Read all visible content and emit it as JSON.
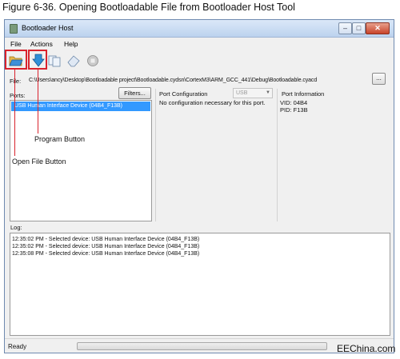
{
  "caption": "Figure 6-36.  Opening Bootloadable File from Bootloader Host Tool",
  "window": {
    "title": "Bootloader Host",
    "controls": {
      "minimize": "–",
      "maximize": "□",
      "close": "✕"
    }
  },
  "menu": {
    "file": "File",
    "actions": "Actions",
    "help": "Help"
  },
  "toolbar": {
    "icons": [
      "folder-open-icon",
      "program-arrow-icon",
      "copy-icon",
      "erase-icon",
      "stop-icon"
    ]
  },
  "file": {
    "label": "File:",
    "path": "C:\\Users\\ancy\\Desktop\\Bootloadable project\\Bootloadable.cydsn\\CortexM3\\ARM_GCC_441\\Debug\\Bootloadable.cyacd",
    "browse_label": "..."
  },
  "ports": {
    "label": "Ports:",
    "filters_label": "Filters...",
    "items": [
      "USB Human Interface Device (04B4_F13B)"
    ]
  },
  "port_config": {
    "label": "Port Configuration",
    "select_value": "USB",
    "message": "No configuration necessary for this port."
  },
  "port_info": {
    "label": "Port Information",
    "vid": "VID: 04B4",
    "pid": "PID: F13B"
  },
  "log": {
    "label": "Log:",
    "lines": [
      "12:35:02 PM - Selected device: USB Human Interface Device (04B4_F13B)",
      "12:35:02 PM - Selected device: USB Human Interface Device (04B4_F13B)",
      "12:35:08 PM - Selected device: USB Human Interface Device (04B4_F13B)"
    ]
  },
  "status": {
    "text": "Ready",
    "progress": 0
  },
  "annotations": {
    "program_button": "Program Button",
    "open_file_button": "Open File Button",
    "highlight_color": "#d9232d"
  },
  "watermark": "EEChina.com"
}
